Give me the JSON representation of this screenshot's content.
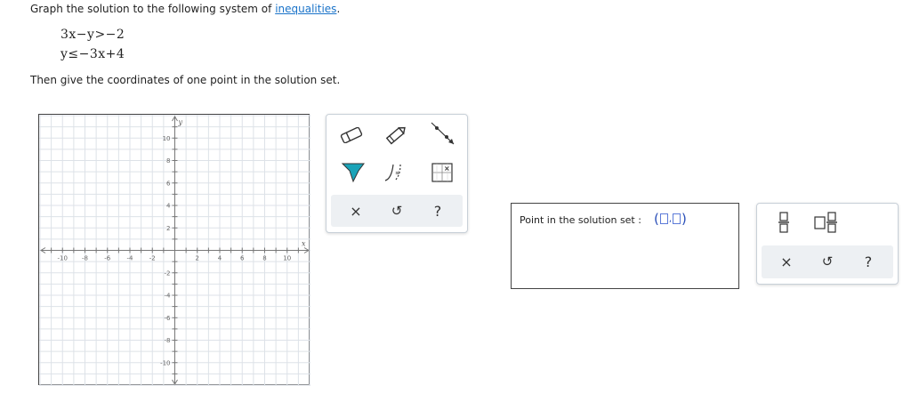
{
  "prompt": {
    "prefix": "Graph the solution to the following system of ",
    "link": "inequalities",
    "suffix": "."
  },
  "inequalities": [
    "3x−y>−2",
    "y≤−3x+4"
  ],
  "instruction": "Then give the coordinates of one point in the solution set.",
  "graph": {
    "x_axis_label": "x",
    "y_axis_label": "y",
    "x_ticks": [
      "-10",
      "-8",
      "-6",
      "-4",
      "-2",
      "2",
      "4",
      "6",
      "8",
      "10"
    ],
    "y_ticks": [
      "10",
      "8",
      "6",
      "4",
      "2",
      "-2",
      "-4",
      "-6",
      "-8",
      "-10"
    ],
    "range": [
      -12,
      12
    ],
    "grid_color": "#dde2e8",
    "axis_color": "#777777"
  },
  "graph_tools": {
    "items": [
      "eraser-icon",
      "pencil-icon",
      "line-tool-icon",
      "shade-region-icon",
      "dashed-curve-icon",
      "solution-point-icon"
    ],
    "accent": "#1aa3b8",
    "actions": [
      "×",
      "↺",
      "?"
    ]
  },
  "answer": {
    "label": "Point in the solution set :",
    "open": "(",
    "sep": ",",
    "close": ")"
  },
  "math_tools": {
    "items": [
      "fraction-icon",
      "mixed-number-icon"
    ],
    "actions": [
      "×",
      "↺",
      "?"
    ]
  }
}
